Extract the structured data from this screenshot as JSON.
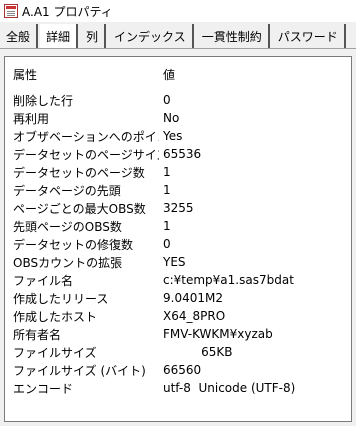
{
  "window": {
    "title": "A.A1 プロパティ"
  },
  "tabs": [
    {
      "label": "全般"
    },
    {
      "label": "詳細"
    },
    {
      "label": "列"
    },
    {
      "label": "インデックス"
    },
    {
      "label": "一貫性制約"
    },
    {
      "label": "パスワード"
    }
  ],
  "table": {
    "header_key": "属性",
    "header_value": "値",
    "rows": [
      {
        "key": "削除した行",
        "value": "0"
      },
      {
        "key": "再利用",
        "value": "No"
      },
      {
        "key": "オブザベーションへのポイント",
        "value": "Yes"
      },
      {
        "key": "データセットのページサイズ",
        "value": "65536"
      },
      {
        "key": "データセットのページ数",
        "value": "1"
      },
      {
        "key": "データページの先頭",
        "value": "1"
      },
      {
        "key": "ページごとの最大OBS数",
        "value": "3255"
      },
      {
        "key": "先頭ページのOBS数",
        "value": "1"
      },
      {
        "key": "データセットの修復数",
        "value": "0"
      },
      {
        "key": "OBSカウントの拡張",
        "value": "YES"
      },
      {
        "key": "ファイル名",
        "value": "c:¥temp¥a1.sas7bdat"
      },
      {
        "key": "作成したリリース",
        "value": "9.0401M2"
      },
      {
        "key": "作成したホスト",
        "value": "X64_8PRO"
      },
      {
        "key": "所有者名",
        "value": "FMV-KWKM¥xyzab"
      },
      {
        "key": "ファイルサイズ",
        "value": "          65KB"
      },
      {
        "key": "ファイルサイズ (バイト)",
        "value": "66560"
      },
      {
        "key": "エンコード",
        "value": "utf-8  Unicode (UTF-8)"
      }
    ]
  }
}
